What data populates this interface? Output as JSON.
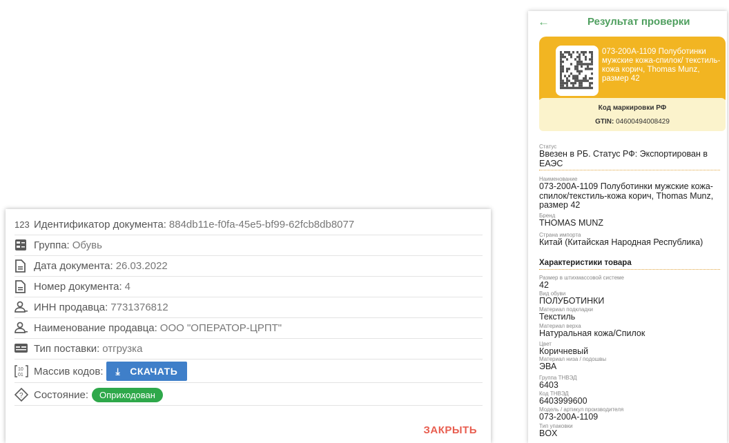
{
  "dialog": {
    "rows": [
      {
        "icon": "number-icon",
        "label": "Идентификатор документа:",
        "value": "884db11e-f0fa-45e5-bf99-62fcb8db8077"
      },
      {
        "icon": "group-icon",
        "label": "Группа:",
        "value": "Обувь"
      },
      {
        "icon": "document-icon",
        "label": "Дата документа:",
        "value": "26.03.2022"
      },
      {
        "icon": "document-icon",
        "label": "Номер документа:",
        "value": "4"
      },
      {
        "icon": "person-icon",
        "label": "ИНН продавца:",
        "value": "7731376812"
      },
      {
        "icon": "person-icon",
        "label": "Наименование продавца:",
        "value": "ООО \"ОПЕРАТОР-ЦРПТ\""
      },
      {
        "icon": "card-icon",
        "label": "Тип поставки:",
        "value": "отгрузка"
      }
    ],
    "codes_label": "Массив кодов:",
    "download_label": "СКАЧАТЬ",
    "state_label": "Состояние:",
    "state_value": "Оприходован",
    "close_label": "ЗАКРЫТЬ",
    "colors": {
      "download": "#3f7fc9",
      "state": "#2ea84a",
      "close": "#e85d4f"
    }
  },
  "phone": {
    "title": "Результат проверки",
    "product_text": "073-200A-1109 Полуботинки мужские кожа-спилок/ текстиль-кожа корич, Thomas Munz, размер 42",
    "code_title": "Код маркировки РФ",
    "gtin_label": "GTIN:",
    "gtin_value": "04600494008429",
    "fields": [
      {
        "k": "Статус",
        "v": "Ввезен в РБ. Статус РФ: Экспортирован в ЕАЭС"
      },
      {
        "k": "Наименование",
        "v": "073-200A-1109 Полуботинки мужские кожа-спилок/текстиль-кожа корич, Thomas Munz, размер 42"
      },
      {
        "k": "Бренд",
        "v": "THOMAS MUNZ"
      },
      {
        "k": "Страна импорта",
        "v": "Китай (Китайская Народная Республика)"
      }
    ],
    "section_title": "Характеристики товара",
    "characteristics": [
      {
        "k": "Размер в штихмассовой системе",
        "v": "42"
      },
      {
        "k": "Вид обуви",
        "v": "ПОЛУБОТИНКИ"
      },
      {
        "k": "Материал подкладки",
        "v": "Текстиль"
      },
      {
        "k": "Материал верха",
        "v": "Натуральная кожа/Спилок"
      },
      {
        "k": "Цвет",
        "v": "Коричневый"
      },
      {
        "k": "Материал низа / подошвы",
        "v": "ЭВА"
      },
      {
        "k": "Группа ТНВЭД",
        "v": "6403"
      },
      {
        "k": "Код ТНВЭД",
        "v": "6403999600"
      },
      {
        "k": "Модель / артикул производителя",
        "v": "073-200A-1109"
      },
      {
        "k": "Тип упаковки",
        "v": "BOX"
      }
    ],
    "colors": {
      "accent": "#f2b522",
      "header": "#4f9f5f",
      "code_bg": "#fbf3cc"
    }
  }
}
